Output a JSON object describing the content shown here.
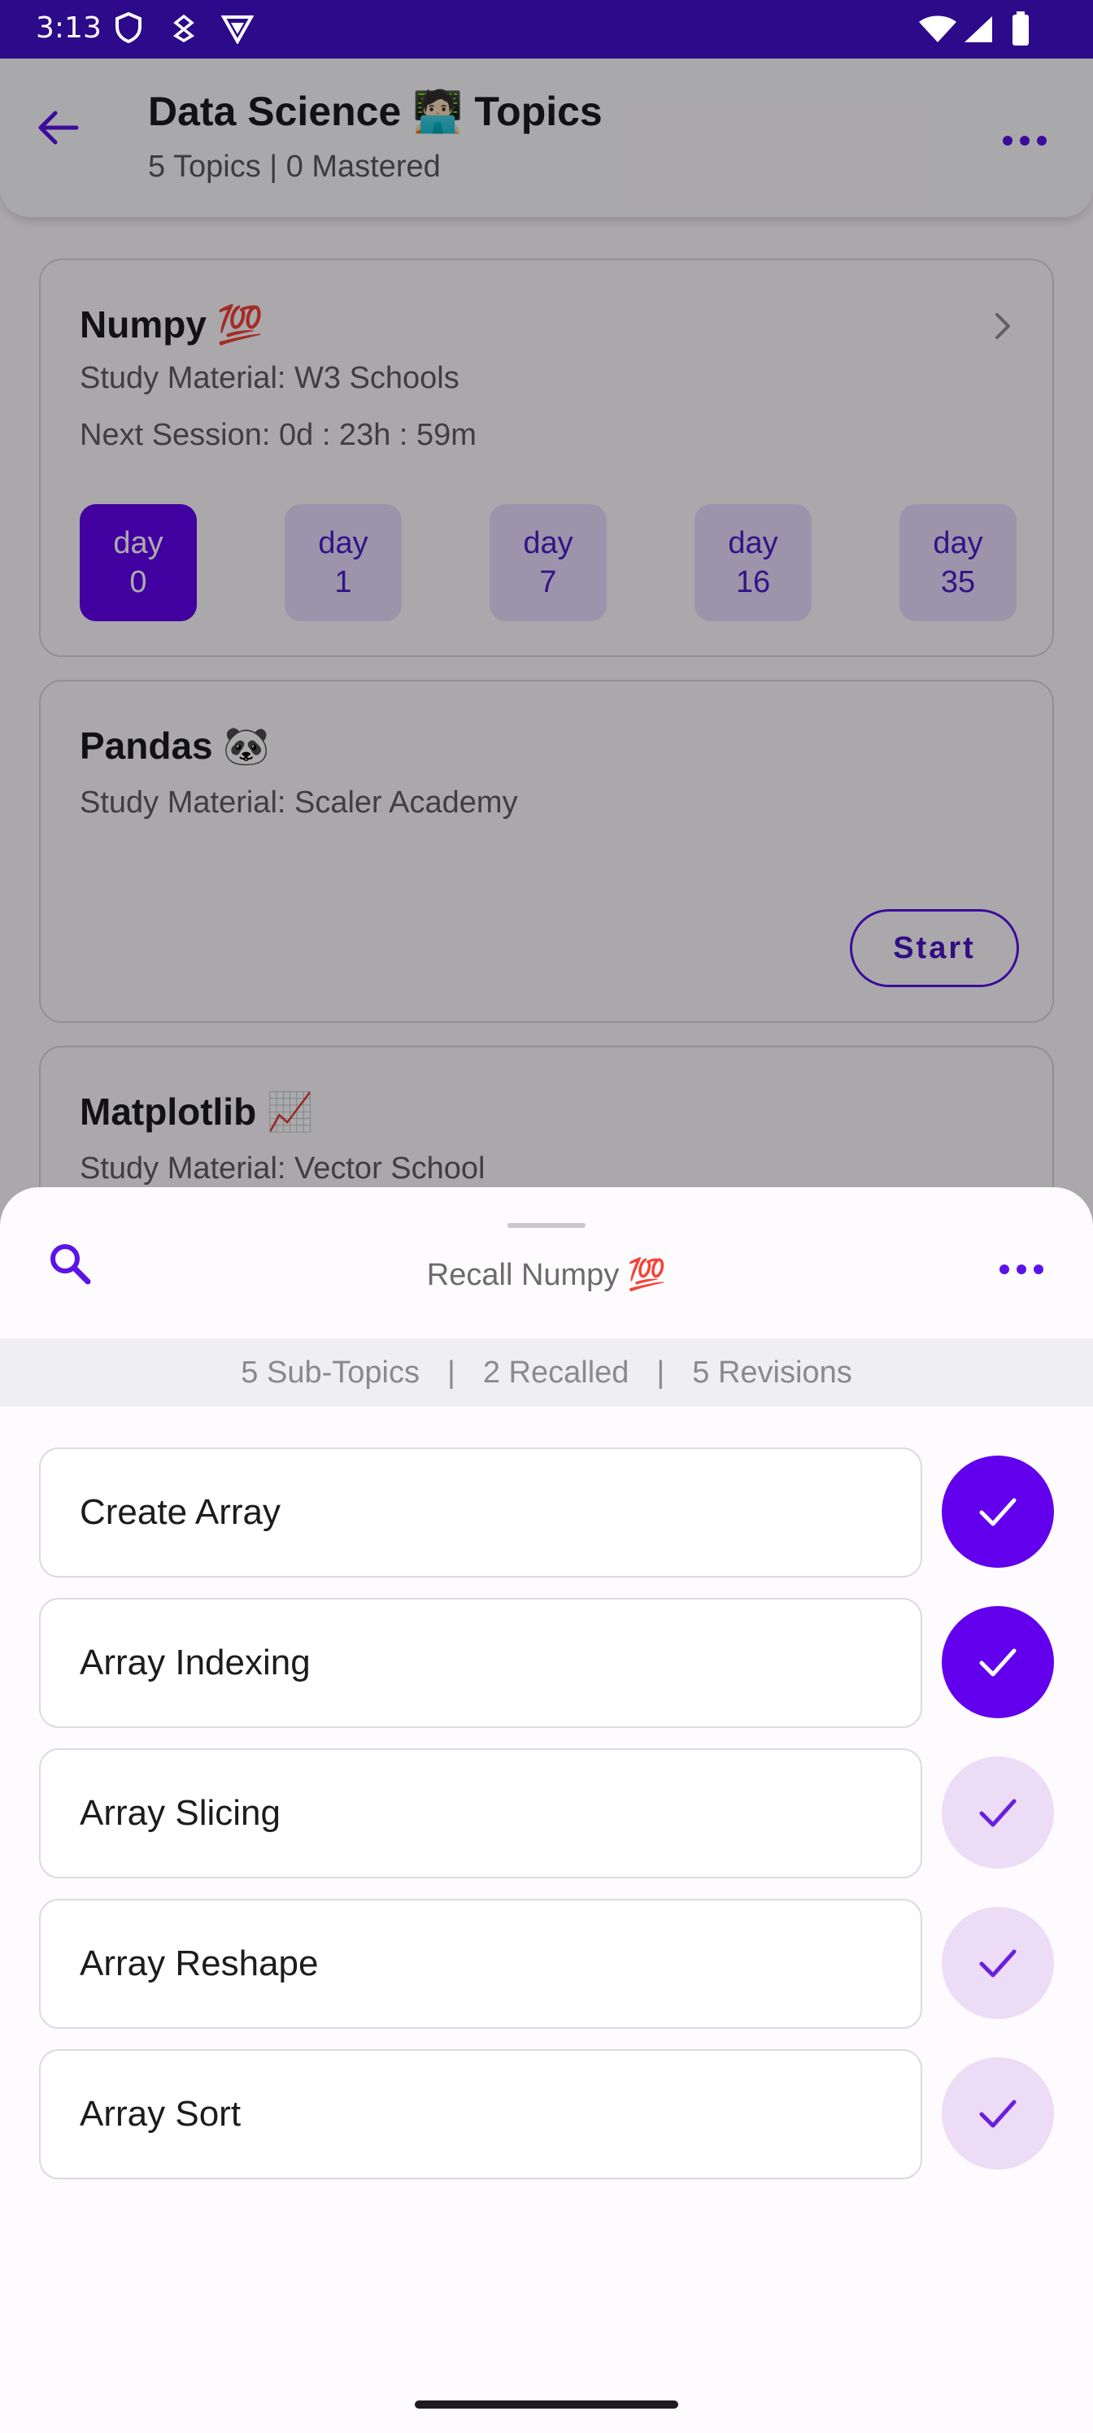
{
  "status_bar": {
    "time": "3:13",
    "icons": [
      "shield-icon",
      "cast-icon",
      "vpn-icon",
      "wifi-icon",
      "signal-icon",
      "battery-icon"
    ]
  },
  "app_bar": {
    "title": "Data Science 🧑🏻‍💻 Topics",
    "subtitle": "5 Topics   |   0 Mastered"
  },
  "topics": [
    {
      "title": "Numpy 💯",
      "study_material": "Study Material: W3 Schools",
      "next_session": "Next Session: 0d : 23h : 59m",
      "days": [
        {
          "label": "day",
          "value": "0",
          "active": true
        },
        {
          "label": "day",
          "value": "1",
          "active": false
        },
        {
          "label": "day",
          "value": "7",
          "active": false
        },
        {
          "label": "day",
          "value": "16",
          "active": false
        },
        {
          "label": "day",
          "value": "35",
          "active": false
        }
      ]
    },
    {
      "title": "Pandas 🐼",
      "study_material": "Study Material: Scaler Academy",
      "action_label": "Start"
    },
    {
      "title": "Matplotlib 📈",
      "study_material": "Study Material: Vector School"
    }
  ],
  "sheet": {
    "title": "Recall Numpy 💯",
    "stats": {
      "subtopics": "5 Sub-Topics",
      "recalled": "2 Recalled",
      "revisions": "5 Revisions"
    },
    "subtopics": [
      {
        "label": "Create Array",
        "recalled": true
      },
      {
        "label": "Array Indexing",
        "recalled": true
      },
      {
        "label": "Array Slicing",
        "recalled": false
      },
      {
        "label": "Array Reshape",
        "recalled": false
      },
      {
        "label": "Array Sort",
        "recalled": false
      }
    ]
  },
  "colors": {
    "status_bar": "#2c0a8a",
    "accent": "#6200ee",
    "accent_light": "#ecdcf6",
    "day_chip": "#e9ddff"
  }
}
